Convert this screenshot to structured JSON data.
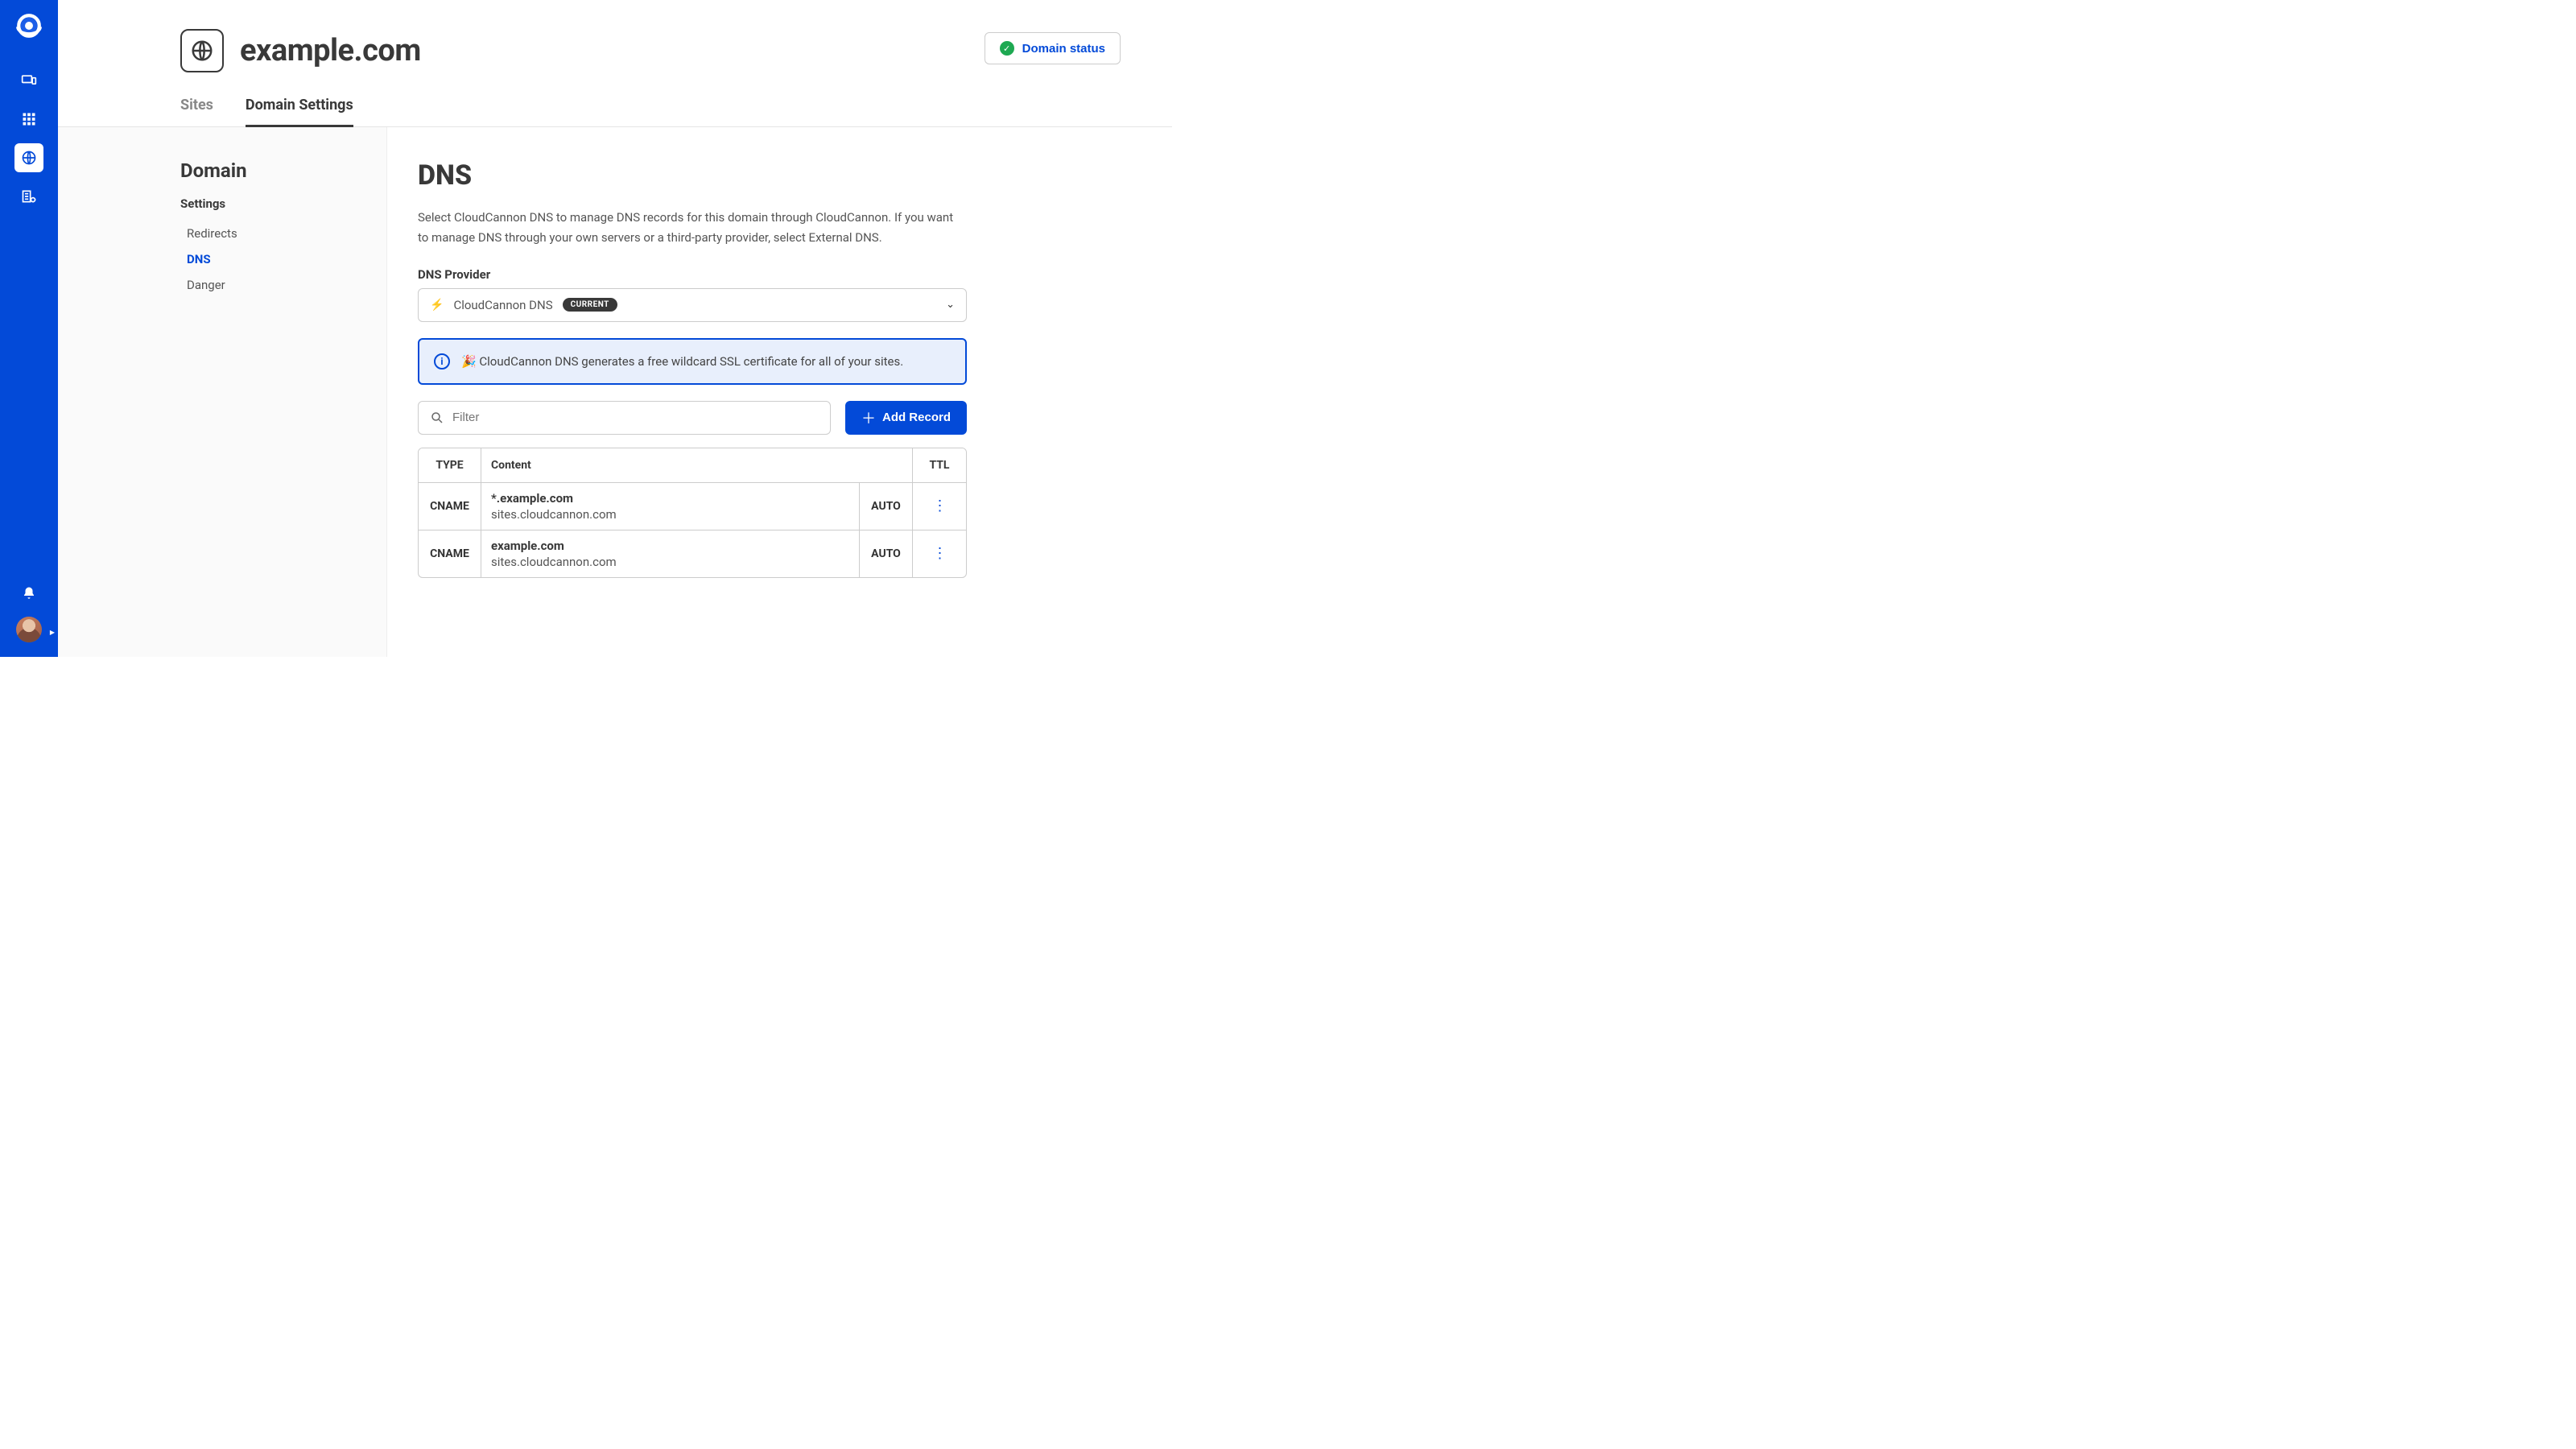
{
  "header": {
    "domain_name": "example.com",
    "status_label": "Domain status"
  },
  "tabs": [
    {
      "label": "Sites",
      "active": false
    },
    {
      "label": "Domain Settings",
      "active": true
    }
  ],
  "leftnav": {
    "heading": "Domain",
    "section_label": "Settings",
    "items": [
      {
        "label": "Redirects",
        "active": false
      },
      {
        "label": "DNS",
        "active": true
      },
      {
        "label": "Danger",
        "active": false
      }
    ]
  },
  "panel": {
    "title": "DNS",
    "description": "Select CloudCannon DNS to manage DNS records for this domain through CloudCannon. If you want to manage DNS through your own servers or a third-party provider, select External DNS.",
    "provider_field_label": "DNS Provider",
    "provider_selected": "CloudCannon DNS",
    "provider_badge": "CURRENT",
    "info_message": "🎉 CloudCannon DNS generates a free wildcard SSL certificate for all of your sites.",
    "filter_placeholder": "Filter",
    "add_button_label": "Add Record",
    "table": {
      "headers": {
        "type": "TYPE",
        "content": "Content",
        "ttl": "TTL"
      },
      "rows": [
        {
          "type": "CNAME",
          "name": "*.example.com",
          "value": "sites.cloudcannon.com",
          "ttl": "AUTO"
        },
        {
          "type": "CNAME",
          "name": "example.com",
          "value": "sites.cloudcannon.com",
          "ttl": "AUTO"
        }
      ]
    }
  }
}
